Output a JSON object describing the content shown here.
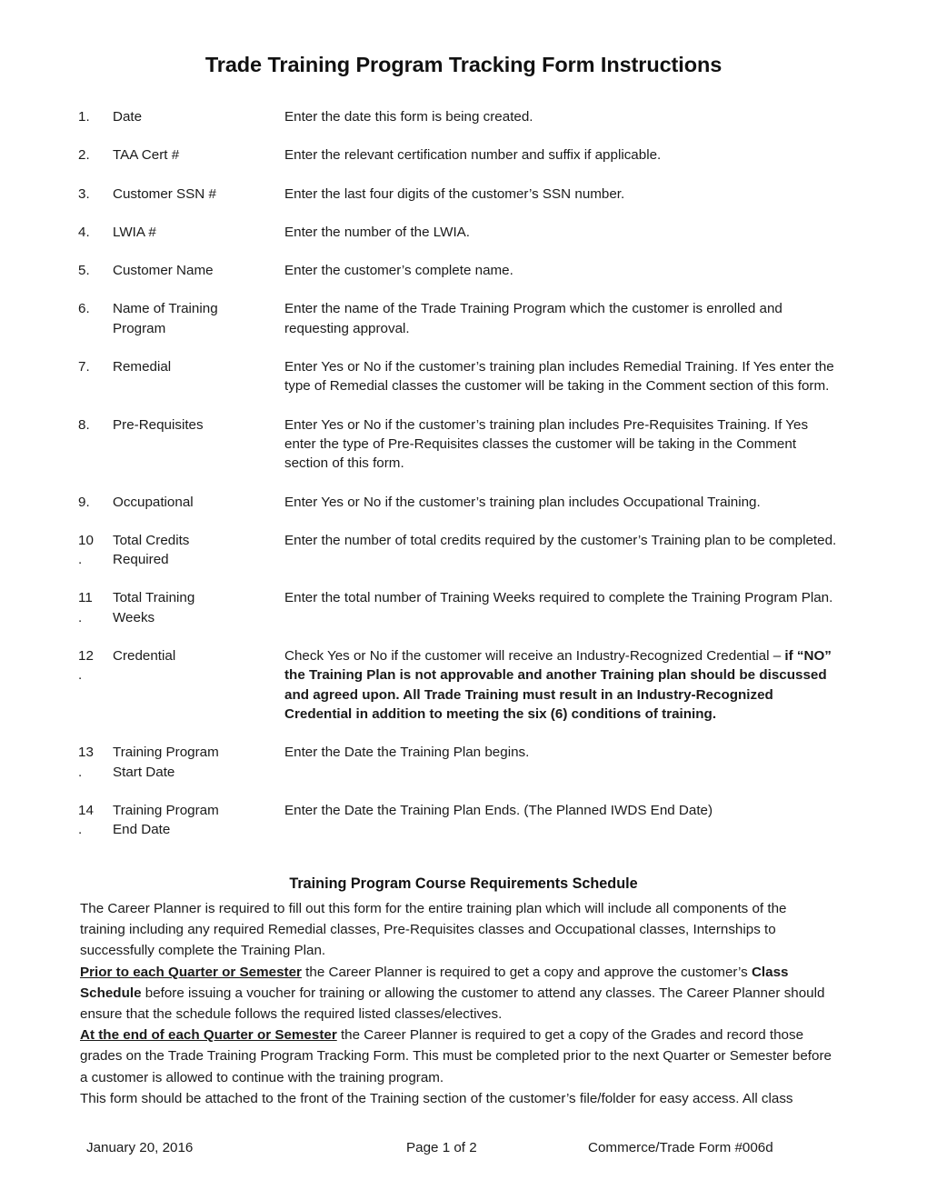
{
  "document": {
    "title": "Trade Training Program Tracking Form Instructions"
  },
  "instructions": [
    {
      "number": "1.",
      "label": "Date",
      "description": "Enter the date this form is being created."
    },
    {
      "number": "2.",
      "label": "TAA Cert #",
      "description": "Enter the relevant certification number and suffix if applicable."
    },
    {
      "number": "3.",
      "label": "Customer SSN #",
      "description": "Enter the last four digits of the customer’s SSN number."
    },
    {
      "number": "4.",
      "label": "LWIA #",
      "description": "Enter the number of the LWIA."
    },
    {
      "number": "5.",
      "label": "Customer Name",
      "description": "Enter the customer’s complete name."
    },
    {
      "number": "6.",
      "label": "Name of Training\nProgram",
      "description": "Enter the name of the Trade Training Program which the customer is enrolled and requesting approval."
    },
    {
      "number": "7.",
      "label": "Remedial",
      "description": "Enter Yes or No if the customer’s training plan includes Remedial Training.  If Yes enter the type of Remedial classes the customer will be taking in the Comment section of this form."
    },
    {
      "number": "8.",
      "label": "Pre-Requisites",
      "description": "Enter Yes or No if the customer’s training plan includes Pre-Requisites Training.  If Yes enter the type of Pre-Requisites classes the customer will be taking in the Comment section of this form."
    },
    {
      "number": "9.",
      "label": "Occupational",
      "description": "Enter Yes or No if the customer’s training plan includes Occupational Training."
    },
    {
      "number": "10\n.",
      "label": "Total Credits\nRequired",
      "description": "Enter the number of total credits required by the customer’s Training plan to be completed."
    },
    {
      "number": "11\n.",
      "label": "Total Training\nWeeks",
      "description": "Enter the total number of Training Weeks required to complete the Training Program Plan."
    },
    {
      "number": "12\n.",
      "label": "Credential",
      "description_plain": "Check Yes or No if the customer will receive an Industry-Recognized Credential – ",
      "description_bold": "if “NO” the Training Plan is not approvable and another Training plan should be discussed and agreed upon.  All Trade Training must result in an Industry-Recognized Credential in addition to meeting the six (6) conditions of training."
    },
    {
      "number": "13\n.",
      "label": "Training Program\nStart Date",
      "description": "Enter the Date the Training Plan begins."
    },
    {
      "number": "14\n.",
      "label": "Training Program\nEnd Date",
      "description": "Enter the Date the Training Plan Ends.  (The Planned IWDS End Date)"
    }
  ],
  "schedule_section": {
    "heading": "Training Program Course Requirements Schedule",
    "paragraph_1": "The Career Planner is required to fill out this form for the entire training plan which will include all components of the training including any required Remedial classes, Pre-Requisites classes and Occupational classes, Internships to successfully complete the Training Plan.",
    "paragraph_2_lead": "Prior to each Quarter or Semester",
    "paragraph_2_mid": " the Career Planner is required to get a copy and approve the customer’s ",
    "paragraph_2_bold": "Class Schedule",
    "paragraph_2_tail": " before issuing a voucher for training or allowing the customer to attend any classes. The Career Planner should ensure that the schedule follows the required listed classes/electives.",
    "paragraph_3_lead": "At the end of each Quarter or Semester",
    "paragraph_3_tail": " the Career Planner is required to get a copy of the Grades and record those grades on the Trade Training Program Tracking Form.  This must be completed prior to the next Quarter or Semester before a customer is allowed to continue with the training program.",
    "paragraph_4": "This form should be attached to the front of the Training section of the customer’s file/folder for easy access.  All class"
  },
  "footer": {
    "date": "January 20, 2016",
    "page": "Page 1 of 2",
    "form_id": "Commerce/Trade Form #006d"
  }
}
